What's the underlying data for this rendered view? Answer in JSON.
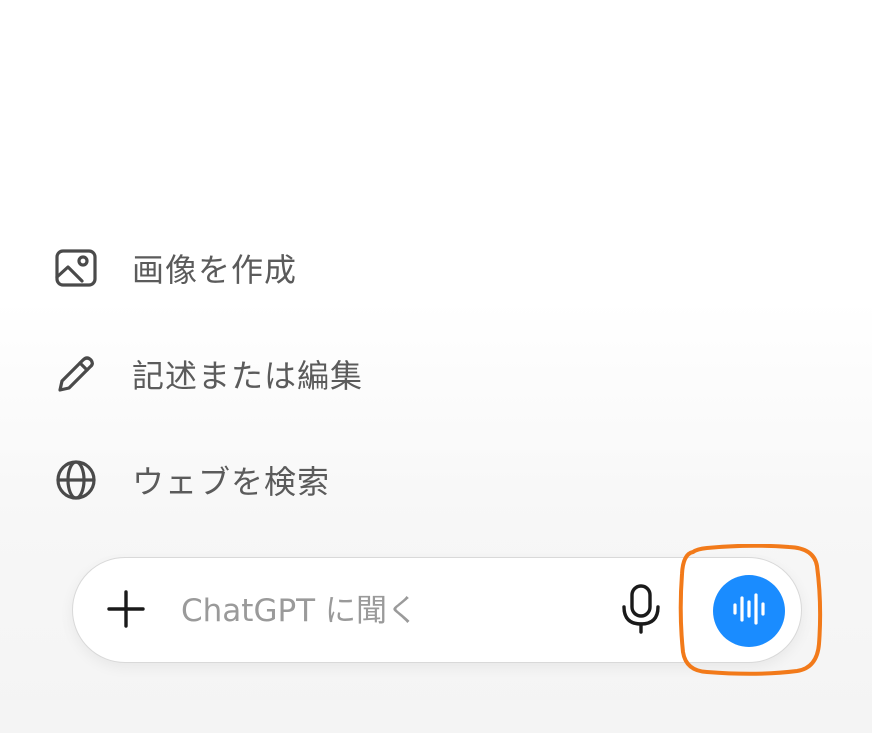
{
  "suggestions": [
    {
      "label": "画像を作成",
      "icon": "image-icon"
    },
    {
      "label": "記述または編集",
      "icon": "pencil-icon"
    },
    {
      "label": "ウェブを検索",
      "icon": "globe-icon"
    }
  ],
  "composer": {
    "placeholder": "ChatGPT に聞く",
    "attach_icon": "plus-icon",
    "mic_icon": "microphone-icon",
    "voice_icon": "voice-waveform-icon"
  },
  "colors": {
    "voice_button": "#1a8cff",
    "highlight": "#f27a1a",
    "suggestion_text": "#5b5b5b"
  }
}
